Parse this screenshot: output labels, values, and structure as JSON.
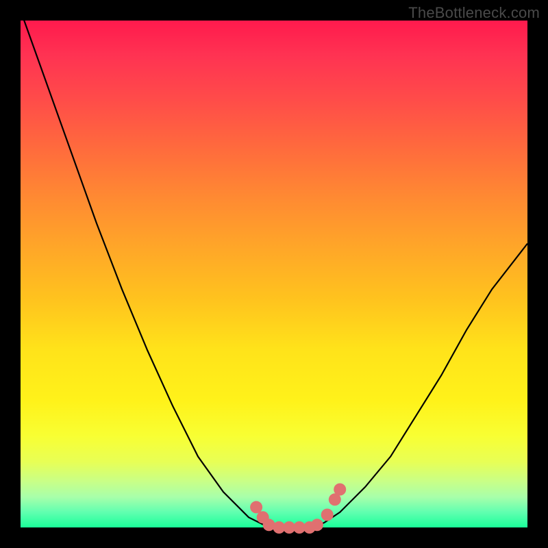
{
  "watermark": "TheBottleneck.com",
  "chart_data": {
    "type": "line",
    "title": "",
    "xlabel": "",
    "ylabel": "",
    "xlim": [
      0,
      1
    ],
    "ylim": [
      0,
      1
    ],
    "grid": false,
    "series": [
      {
        "name": "bottleneck-curve",
        "x": [
          0.0,
          0.05,
          0.1,
          0.15,
          0.2,
          0.25,
          0.3,
          0.35,
          0.4,
          0.45,
          0.49,
          0.5,
          0.55,
          0.58,
          0.6,
          0.63,
          0.68,
          0.73,
          0.78,
          0.83,
          0.88,
          0.93,
          1.0
        ],
        "y": [
          1.02,
          0.88,
          0.74,
          0.6,
          0.47,
          0.35,
          0.24,
          0.14,
          0.07,
          0.02,
          0.0,
          0.0,
          0.0,
          0.0,
          0.01,
          0.03,
          0.08,
          0.14,
          0.22,
          0.3,
          0.39,
          0.47,
          0.56
        ]
      }
    ],
    "markers": {
      "name": "highlight-points",
      "color": "#e07070",
      "points": [
        {
          "x": 0.465,
          "y": 0.04
        },
        {
          "x": 0.478,
          "y": 0.02
        },
        {
          "x": 0.49,
          "y": 0.005
        },
        {
          "x": 0.51,
          "y": 0.0
        },
        {
          "x": 0.53,
          "y": 0.0
        },
        {
          "x": 0.55,
          "y": 0.0
        },
        {
          "x": 0.57,
          "y": 0.0
        },
        {
          "x": 0.585,
          "y": 0.005
        },
        {
          "x": 0.605,
          "y": 0.025
        },
        {
          "x": 0.62,
          "y": 0.055
        },
        {
          "x": 0.63,
          "y": 0.075
        }
      ]
    }
  }
}
